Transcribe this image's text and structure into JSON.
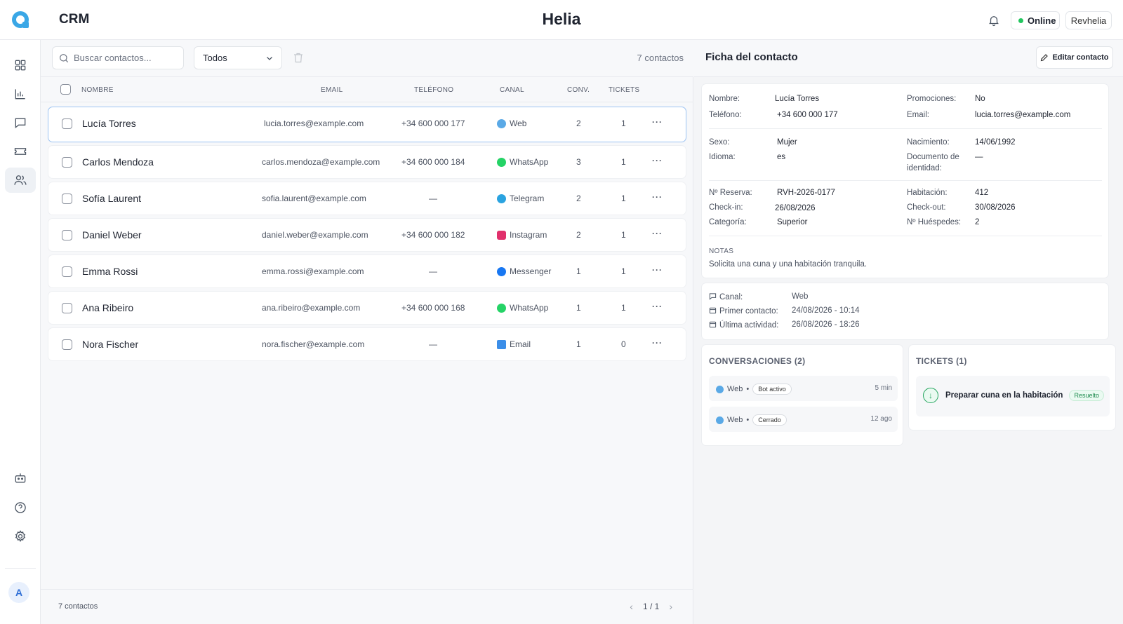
{
  "topbar": {
    "app_title": "CRM",
    "brand": "Helia",
    "status": "Online",
    "user": "Revhelia",
    "colors": {
      "online": "#22c55e",
      "accent": "#3aa7e6"
    }
  },
  "rail": {
    "items": [
      "dashboard-icon",
      "analytics-icon",
      "chat-icon",
      "ticket-icon",
      "contacts-icon",
      "bot-icon",
      "help-icon",
      "settings-icon"
    ],
    "avatar": "A"
  },
  "toolbar": {
    "search_placeholder": "Buscar contactos...",
    "filter_value": "Todos",
    "count": "7 contactos"
  },
  "table": {
    "headers": {
      "name": "NOMBRE",
      "email": "EMAIL",
      "phone": "TELÉFONO",
      "channel": "CANAL",
      "conv": "CONV.",
      "tickets": "TICKETS"
    },
    "rows": [
      {
        "name": "Lucía Torres",
        "email": "lucia.torres@example.com",
        "phone": "+34 600 000 177",
        "channel": "Web",
        "channel_color": "#5aa9e6",
        "conv": "2",
        "tickets": "1"
      },
      {
        "name": "Carlos Mendoza",
        "email": "carlos.mendoza@example.com",
        "phone": "+34 600 000 184",
        "channel": "WhatsApp",
        "channel_color": "#25d366",
        "conv": "3",
        "tickets": "1"
      },
      {
        "name": "Sofía Laurent",
        "email": "sofia.laurent@example.com",
        "phone": "—",
        "channel": "Telegram",
        "channel_color": "#2aa3e0",
        "conv": "2",
        "tickets": "1"
      },
      {
        "name": "Daniel Weber",
        "email": "daniel.weber@example.com",
        "phone": "+34 600 000 182",
        "channel": "Instagram",
        "channel_color": "#e1306c",
        "conv": "2",
        "tickets": "1"
      },
      {
        "name": "Emma Rossi",
        "email": "emma.rossi@example.com",
        "phone": "—",
        "channel": "Messenger",
        "channel_color": "#1877f2",
        "conv": "1",
        "tickets": "1"
      },
      {
        "name": "Ana Ribeiro",
        "email": "ana.ribeiro@example.com",
        "phone": "+34 600 000 168",
        "channel": "WhatsApp",
        "channel_color": "#25d366",
        "conv": "1",
        "tickets": "1"
      },
      {
        "name": "Nora Fischer",
        "email": "nora.fischer@example.com",
        "phone": "—",
        "channel": "Email",
        "channel_color": "#3b8ee8",
        "conv": "1",
        "tickets": "0"
      }
    ],
    "row_menu": "···"
  },
  "footer": {
    "count": "7 contactos",
    "page": "1 / 1",
    "prev": "‹",
    "next": "›"
  },
  "panel": {
    "title": "Ficha del contacto",
    "edit": "Editar contacto",
    "fields": {
      "nombre_k": "Nombre:",
      "nombre_v": "Lucía Torres",
      "promo_k": "Promociones:",
      "promo_v": "No",
      "tel_k": "Teléfono:",
      "tel_v": "+34 600 000 177",
      "email_k": "Email:",
      "email_v": "lucia.torres@example.com",
      "sexo_k": "Sexo:",
      "sexo_v": "Mujer",
      "nac_k": "Nacimiento:",
      "nac_v": "14/06/1992",
      "idioma_k": "Idioma:",
      "idioma_v": "es",
      "doc_k1": "Documento de",
      "doc_k2": "identidad:",
      "doc_v": "—",
      "res_k": "Nº Reserva:",
      "res_v": "RVH-2026-0177",
      "hab_k": "Habitación:",
      "hab_v": "412",
      "in_k": "Check-in:",
      "in_v": "26/08/2026",
      "out_k": "Check-out:",
      "out_v": "30/08/2026",
      "cat_k": "Categoría:",
      "cat_v": "Superior",
      "hue_k": "Nº Huéspedes:",
      "hue_v": "2"
    },
    "notes_label": "NOTAS",
    "notes": "Solicita una cuna y una habitación tranquila.",
    "meta": {
      "canal_k": "Canal:",
      "canal_v": "Web",
      "primer_k": "Primer contacto:",
      "primer_v": "24/08/2026 - 10:14",
      "ultima_k": "Última actividad:",
      "ultima_v": "26/08/2026 - 18:26"
    },
    "conversations": {
      "title": "CONVERSACIONES (2)",
      "items": [
        {
          "channel": "Web",
          "status": "Bot activo",
          "time": "5 min"
        },
        {
          "channel": "Web",
          "status": "Cerrado",
          "time": "12 ago"
        }
      ]
    },
    "tickets": {
      "title": "TICKETS (1)",
      "items": [
        {
          "title": "Preparar cuna en la habitación",
          "status": "Resuelto"
        }
      ]
    }
  }
}
